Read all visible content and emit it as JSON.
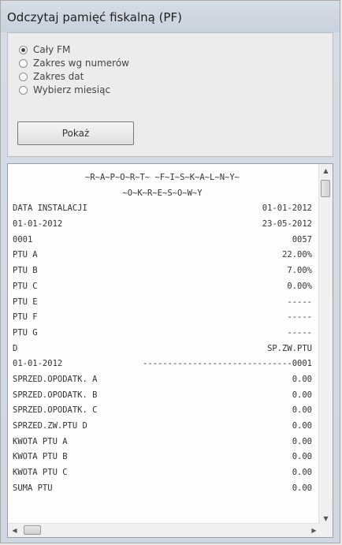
{
  "window": {
    "title": "Odczytaj pamięć fiskalną (PF)"
  },
  "options": [
    {
      "label": "Cały FM",
      "checked": true
    },
    {
      "label": "Zakres wg numerów",
      "checked": false
    },
    {
      "label": "Zakres dat",
      "checked": false
    },
    {
      "label": "Wybierz miesiąc",
      "checked": false
    }
  ],
  "show_button": {
    "label": "Pokaż"
  },
  "report": {
    "header1": "~R~A~P~O~R~T~ ~F~I~S~K~A~L~N~Y~",
    "header2": "~O~K~R~E~S~O~W~Y",
    "rows": [
      {
        "left": "DATA INSTALACJI",
        "right": "01-01-2012"
      },
      {
        "left": "01-01-2012",
        "right": "23-05-2012"
      },
      {
        "left": "0001",
        "right": "0057"
      },
      {
        "left": "PTU A",
        "right": "22.00%"
      },
      {
        "left": "PTU B",
        "right": "7.00%"
      },
      {
        "left": "PTU C",
        "right": "0.00%"
      },
      {
        "left": "PTU E",
        "right": "-----"
      },
      {
        "left": "PTU F",
        "right": "-----"
      },
      {
        "left": "PTU G",
        "right": "-----"
      },
      {
        "left": "D",
        "right": "SP.ZW.PTU"
      },
      {
        "left": "01-01-2012",
        "right": "------------------------------0001"
      },
      {
        "left": "SPRZED.OPODATK. A",
        "right": "0.00"
      },
      {
        "left": "SPRZED.OPODATK. B",
        "right": "0.00"
      },
      {
        "left": "SPRZED.OPODATK. C",
        "right": "0.00"
      },
      {
        "left": "SPRZED.ZW.PTU D",
        "right": "0.00"
      },
      {
        "left": "KWOTA PTU A",
        "right": "0.00"
      },
      {
        "left": "KWOTA PTU B",
        "right": "0.00"
      },
      {
        "left": "KWOTA PTU C",
        "right": "0.00"
      },
      {
        "left": "SUMA PTU",
        "right": "0.00"
      }
    ]
  },
  "scrollbars": {
    "up_icon": "arrow-up-icon",
    "down_icon": "arrow-down-icon",
    "left_icon": "arrow-left-icon",
    "right_icon": "arrow-right-icon"
  }
}
